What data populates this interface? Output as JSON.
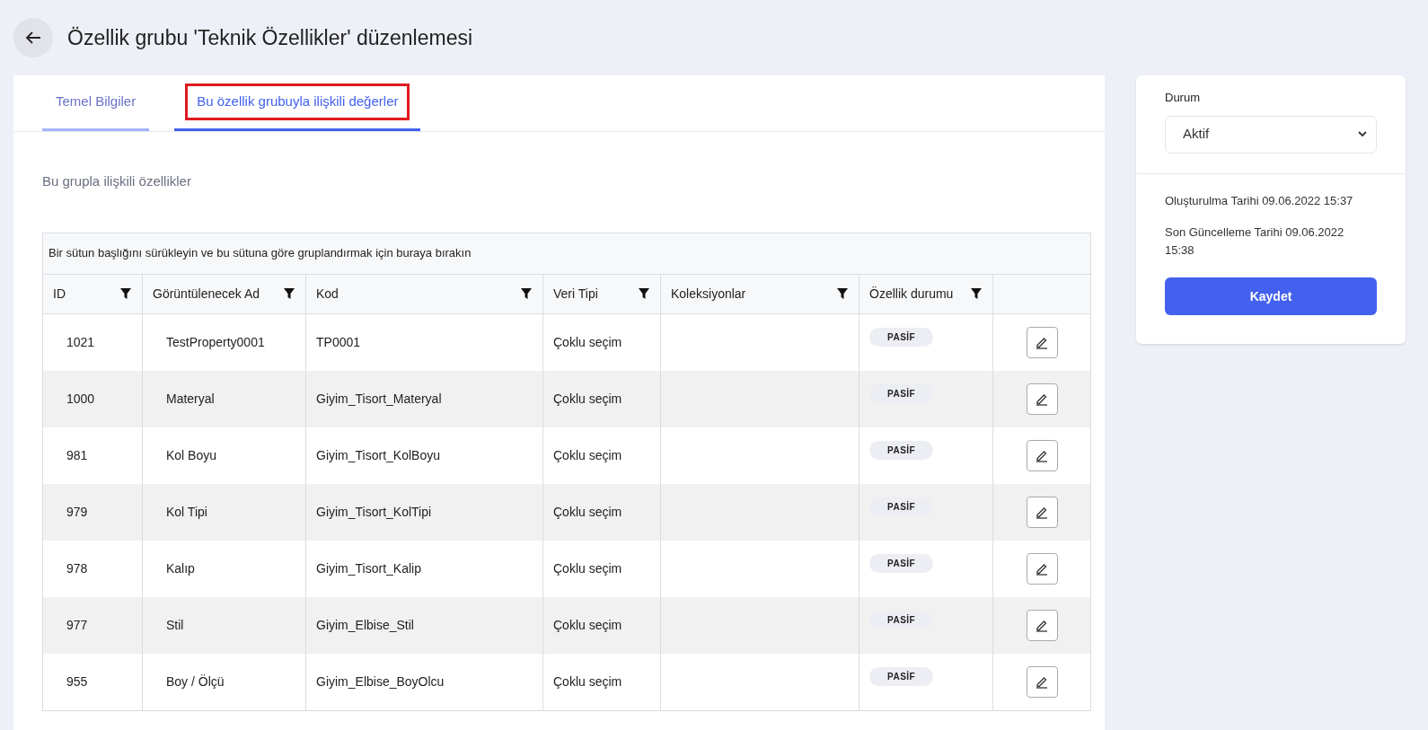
{
  "header": {
    "title": "Özellik grubu 'Teknik Özellikler' düzenlemesi"
  },
  "tabs": [
    {
      "label": "Temel Bilgiler",
      "selected": false,
      "highlighted": false
    },
    {
      "label": "Bu özellik grubuyla ilişkili değerler",
      "selected": true,
      "highlighted": true
    }
  ],
  "section_title": "Bu grupla ilişkili özellikler",
  "table": {
    "group_hint": "Bir sütun başlığını sürükleyin ve bu sütuna göre gruplandırmak için buraya bırakın",
    "columns": [
      {
        "label": "ID"
      },
      {
        "label": "Görüntülenecek Ad"
      },
      {
        "label": "Kod"
      },
      {
        "label": "Veri Tipi"
      },
      {
        "label": "Koleksiyonlar"
      },
      {
        "label": "Özellik durumu"
      }
    ],
    "rows": [
      {
        "id": "1021",
        "name": "TestProperty0001",
        "code": "TP0001",
        "type": "Çoklu seçim",
        "status": "PASİF"
      },
      {
        "id": "1000",
        "name": "Materyal",
        "code": "Giyim_Tisort_Materyal",
        "type": "Çoklu seçim",
        "status": "PASİF"
      },
      {
        "id": "981",
        "name": "Kol Boyu",
        "code": "Giyim_Tisort_KolBoyu",
        "type": "Çoklu seçim",
        "status": "PASİF"
      },
      {
        "id": "979",
        "name": "Kol Tipi",
        "code": "Giyim_Tisort_KolTipi",
        "type": "Çoklu seçim",
        "status": "PASİF"
      },
      {
        "id": "978",
        "name": "Kalıp",
        "code": "Giyim_Tisort_Kalip",
        "type": "Çoklu seçim",
        "status": "PASİF"
      },
      {
        "id": "977",
        "name": "Stil",
        "code": "Giyim_Elbise_Stil",
        "type": "Çoklu seçim",
        "status": "PASİF"
      },
      {
        "id": "955",
        "name": "Boy / Ölçü",
        "code": "Giyim_Elbise_BoyOlcu",
        "type": "Çoklu seçim",
        "status": "PASİF"
      }
    ]
  },
  "side": {
    "status_label": "Durum",
    "status_value": "Aktif",
    "created": "Oluşturulma Tarihi 09.06.2022 15:37",
    "updated": "Son Güncelleme Tarihi 09.06.2022 15:38",
    "save": "Kaydet"
  }
}
